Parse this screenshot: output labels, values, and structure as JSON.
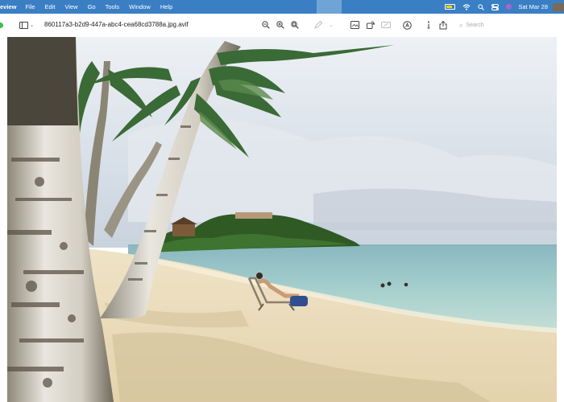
{
  "menubar": {
    "app_name": "eview",
    "menus": [
      "File",
      "Edit",
      "View",
      "Go",
      "Tools",
      "Window",
      "Help"
    ],
    "clock": "Sat Mar 28",
    "status_icons": [
      "battery-icon",
      "wifi-icon",
      "spotlight-icon",
      "control-center-icon",
      "siri-icon"
    ]
  },
  "toolbar": {
    "document_title": "860117a3-b2d9-447a-abc4-cea68cd3788a.jpg.avif",
    "search_placeholder": "Search",
    "icons": [
      "zoom-out-icon",
      "zoom-in-icon",
      "zoom-fit-icon",
      "markup-pen-icon",
      "markup-chevron-icon",
      "crop-select-icon",
      "rotate-icon",
      "adjust-size-icon",
      "annotate-icon",
      "info-icon",
      "share-icon"
    ]
  },
  "image": {
    "description_colors": {
      "sky": "#dfe6ee",
      "sea": "#9cc9cc",
      "sand": "#eadcbb"
    }
  }
}
